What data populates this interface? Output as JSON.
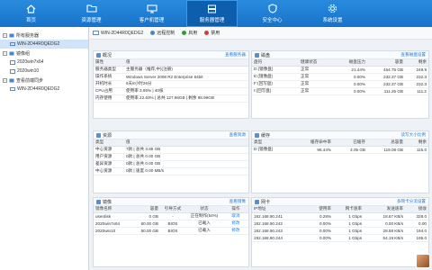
{
  "topnav": [
    {
      "label": "首页",
      "icon": "home-icon"
    },
    {
      "label": "资源管理",
      "icon": "folder-icon"
    },
    {
      "label": "客户机管理",
      "icon": "monitor-icon"
    },
    {
      "label": "服务器管理",
      "icon": "server-icon",
      "active": true
    },
    {
      "label": "安全中心",
      "icon": "shield-icon"
    },
    {
      "label": "系统设置",
      "icon": "gear-icon"
    }
  ],
  "sidebar": {
    "groups": [
      {
        "label": "所有服务器",
        "items": [
          "WIN-2D44R0QEDG2"
        ]
      },
      {
        "label": "镜像组",
        "items": [
          "2020win7x64",
          "2020win10"
        ]
      },
      {
        "label": "查看前端同步",
        "items": [
          "WIN-2D44R0QEDG2"
        ]
      }
    ]
  },
  "toolbar": {
    "host": "WIN-2D44R0QEDG2",
    "remote": "远程控制",
    "enable": "启用",
    "disable": "禁用"
  },
  "overview": {
    "title": "概况",
    "link": "查看服务器",
    "headers": [
      "属性",
      "值"
    ],
    "rows": [
      [
        "服务器类型",
        "主服务器（推荐,中)(注册)"
      ],
      [
        "操作系统",
        "Windows Server 2008 R2 Enterprise 64bit"
      ],
      [
        "开机时长",
        "6天8小时26分"
      ],
      [
        "CPU占用",
        "使用率 3.95% | 40核"
      ],
      [
        "内存使用",
        "使用率 22.63% | 总共 127.96GB | 剩余 98.99GB"
      ]
    ]
  },
  "disk": {
    "title": "磁盘",
    "link": "查看磁盘设置",
    "headers": [
      "盘符",
      "健康状态",
      "磁盘压力",
      "容量",
      "剩余"
    ],
    "rows": [
      [
        "D:(镜像盘)",
        "正常",
        "21.44%",
        "464.75 GB",
        "248.9"
      ],
      [
        "E:(镜像盘)",
        "正常",
        "0.00%",
        "232.37 GB",
        "232.3"
      ],
      [
        "F:(回写盘)",
        "正常",
        "0.00%",
        "232.37 GB",
        "232.3"
      ],
      [
        "I:(回写盘)",
        "正常",
        "0.00%",
        "111.25 GB",
        "111.2"
      ]
    ]
  },
  "resources": {
    "title": "资源",
    "link": "查看资源",
    "headers": [
      "类型",
      "值"
    ],
    "rows": [
      [
        "中心资源",
        "7款 | 总共 3.85 GB"
      ],
      [
        "用户资源",
        "0款 | 总共 0.00 GB"
      ],
      [
        "差异资源",
        "0款 | 总共 0.00 GB"
      ],
      [
        "中心资源",
        "0款 | 速度 0.00 MB/s"
      ]
    ]
  },
  "cache": {
    "title": "缓存",
    "link": "读写大小比例",
    "headers": [
      "类型",
      "缓存命中率",
      "已缓存",
      "总容量",
      "剩余"
    ],
    "rows": [
      [
        "D:(镜像盘)",
        "98.44%",
        "4.05 GB",
        "119.08 GB",
        "115.0"
      ]
    ]
  },
  "images": {
    "title": "镜像",
    "link": "查看镜像",
    "headers": [
      "镜像名称",
      "容量",
      "引导方式",
      "状态",
      "操作"
    ],
    "rows": [
      [
        "userdisk",
        "0 GB",
        "-",
        "正在制作(54%)",
        "取消"
      ],
      [
        "2020win7x64",
        "60.00 GB",
        "BIOS",
        "已载入",
        "修改"
      ],
      [
        "2020win10",
        "50.00 GB",
        "BIOS",
        "已载入",
        "修改"
      ]
    ]
  },
  "nic": {
    "title": "网卡",
    "link": "多网卡分流设置",
    "headers": [
      "IP地址",
      "使用率",
      "网卡速率",
      "发送速率",
      "接收"
    ],
    "rows": [
      [
        "192.168.90.241",
        "0.28%",
        "1 Gbps",
        "18.67 KB/s",
        "328.0"
      ],
      [
        "192.168.90.242",
        "0.00%",
        "1 Gbps",
        "0.00 KB/s",
        "0.00"
      ],
      [
        "192.168.90.243",
        "0.00%",
        "1 Gbps",
        "28.58 KB/s",
        "194.0"
      ],
      [
        "192.168.90.244",
        "0.00%",
        "1 Gbps",
        "54.19 KB/s",
        "195.0"
      ]
    ]
  },
  "colors": {
    "accent": "#1673c9",
    "active_tab": "#0d5fae",
    "enable": "#2e9b3c",
    "disable": "#c94040",
    "progress": "#5bb04f"
  }
}
